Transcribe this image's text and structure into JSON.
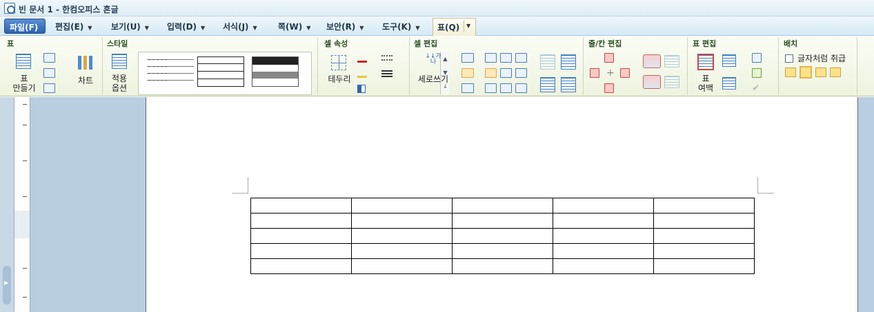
{
  "window": {
    "title": "빈 문서 1 - 한컴오피스 혼글"
  },
  "menu": [
    {
      "label": "파일(F)"
    },
    {
      "label": "편집(E)"
    },
    {
      "label": "보기(U)"
    },
    {
      "label": "입력(D)"
    },
    {
      "label": "서식(J)"
    },
    {
      "label": "쪽(W)"
    },
    {
      "label": "보안(R)"
    },
    {
      "label": "도구(K)"
    },
    {
      "label": "표(Q)"
    }
  ],
  "ribbon": {
    "groups": {
      "table": "표",
      "style": "스타일",
      "cell_props": "셀 속성",
      "cell_edit": "셀 편집",
      "row_col_edit": "줄/칸 편집",
      "table_edit": "표 편집",
      "arrange": "배치"
    },
    "buttons": {
      "make_table_1": "표",
      "make_table_2": "만들기",
      "chart": "차트",
      "apply_1": "적용",
      "apply_2": "옵션",
      "border": "테두리",
      "vertical_write": "세로쓰기",
      "margin_1": "표",
      "margin_2": "여백",
      "treat_as_char": "글자처럼 취급"
    }
  },
  "document": {
    "table_rows": 5,
    "table_cols": 5
  },
  "colors": {
    "accent": "#2d63b0",
    "ribbon": "#eef3df",
    "workspace": "#b8cfe2"
  }
}
